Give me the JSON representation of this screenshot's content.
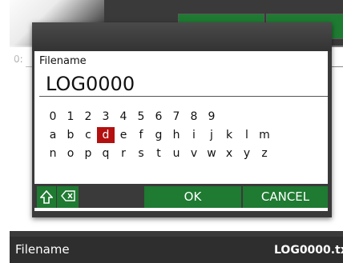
{
  "background": {
    "row_label": "0:",
    "footer_label": "Filename",
    "footer_value": "LOG0000.tx"
  },
  "dialog": {
    "field_label": "Filename",
    "field_value": "LOG0000",
    "keyboard": {
      "rows": [
        [
          "0",
          "1",
          "2",
          "3",
          "4",
          "5",
          "6",
          "7",
          "8",
          "9"
        ],
        [
          "a",
          "b",
          "c",
          "d",
          "e",
          "f",
          "g",
          "h",
          "i",
          "j",
          "k",
          "l",
          "m"
        ],
        [
          "n",
          "o",
          "p",
          "q",
          "r",
          "s",
          "t",
          "u",
          "v",
          "w",
          "x",
          "y",
          "z"
        ]
      ],
      "selected_key": "d"
    },
    "buttons": {
      "shift_icon": "shift-icon",
      "backspace_icon": "backspace-icon",
      "ok": "OK",
      "cancel": "CANCEL"
    }
  },
  "colors": {
    "accent_green": "#1f7a32",
    "selected_key": "#b3100f",
    "chrome_dark": "#3a3a3a"
  }
}
